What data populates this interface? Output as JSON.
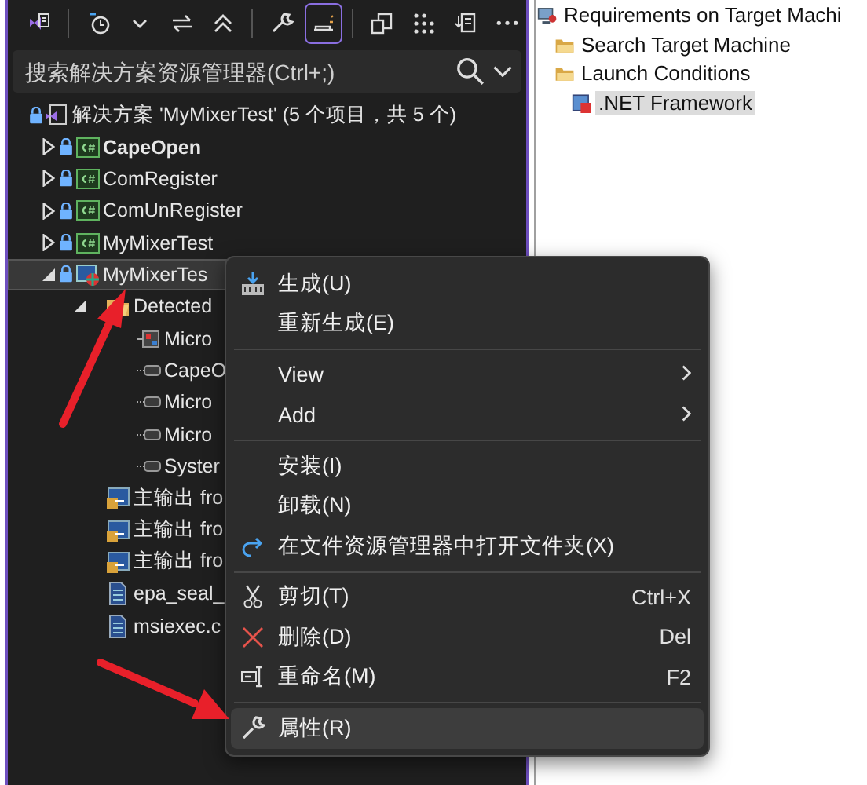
{
  "toolbar": {
    "buttons": [
      {
        "selected": false
      },
      {
        "selected": false
      },
      {
        "selected": false
      },
      {
        "selected": false
      },
      {
        "selected": false
      },
      {
        "selected": false
      },
      {
        "selected": true
      },
      {
        "selected": false
      },
      {
        "selected": false
      },
      {
        "selected": false
      },
      {
        "selected": false
      }
    ]
  },
  "search": {
    "placeholder": "搜索解决方案资源管理器(Ctrl+;)"
  },
  "solution_explorer": {
    "items": [
      {
        "label": "解决方案 'MyMixerTest' (5 个项目，共 5 个)",
        "kind": "solution",
        "locked": true,
        "bold": false,
        "selected": false,
        "children": [
          {
            "label": "CapeOpen",
            "kind": "csharp",
            "locked": true,
            "bold": true,
            "selected": false,
            "expanded": false
          },
          {
            "label": "ComRegister",
            "kind": "csharp",
            "locked": true,
            "bold": false,
            "selected": false,
            "expanded": false
          },
          {
            "label": "ComUnRegister",
            "kind": "csharp",
            "locked": true,
            "bold": false,
            "selected": false,
            "expanded": false
          },
          {
            "label": "MyMixerTest",
            "kind": "csharp",
            "locked": true,
            "bold": false,
            "selected": false,
            "expanded": false
          },
          {
            "label": "MyMixerTes",
            "kind": "setup",
            "locked": true,
            "bold": false,
            "selected": true,
            "expanded": true,
            "children": [
              {
                "label": "Detected",
                "kind": "folder",
                "locked": false,
                "bold": false,
                "selected": false,
                "expanded": true,
                "children": [
                  {
                    "label": "Micro",
                    "kind": "module",
                    "locked": false,
                    "bold": false,
                    "selected": false
                  },
                  {
                    "label": "CapeO",
                    "kind": "dependency",
                    "locked": false,
                    "bold": false,
                    "selected": false
                  },
                  {
                    "label": "Micro",
                    "kind": "dependency",
                    "locked": false,
                    "bold": false,
                    "selected": false
                  },
                  {
                    "label": "Micro",
                    "kind": "dependency",
                    "locked": false,
                    "bold": false,
                    "selected": false
                  },
                  {
                    "label": "Syster",
                    "kind": "dependency",
                    "locked": false,
                    "bold": false,
                    "selected": false
                  }
                ]
              },
              {
                "label": "主输出 fro",
                "kind": "output",
                "locked": false,
                "bold": false,
                "selected": false
              },
              {
                "label": "主输出 fro",
                "kind": "output",
                "locked": false,
                "bold": false,
                "selected": false
              },
              {
                "label": "主输出 fro",
                "kind": "output",
                "locked": false,
                "bold": false,
                "selected": false
              },
              {
                "label": "epa_seal_",
                "kind": "file",
                "locked": false,
                "bold": false,
                "selected": false
              },
              {
                "label": "msiexec.c",
                "kind": "file",
                "locked": false,
                "bold": false,
                "selected": false
              }
            ]
          }
        ]
      }
    ]
  },
  "context_menu": {
    "groups": [
      [
        {
          "label": "生成(U)",
          "submenu": false,
          "selected": false
        },
        {
          "label": "重新生成(E)",
          "submenu": false,
          "selected": false
        }
      ],
      [
        {
          "label": "View",
          "submenu": true,
          "selected": false
        },
        {
          "label": "Add",
          "submenu": true,
          "selected": false
        }
      ],
      [
        {
          "label": "安装(I)",
          "submenu": false,
          "selected": false
        },
        {
          "label": "卸载(N)",
          "submenu": false,
          "selected": false
        },
        {
          "label": "在文件资源管理器中打开文件夹(X)",
          "submenu": false,
          "selected": false
        }
      ],
      [
        {
          "label": "剪切(T)",
          "shortcut": "Ctrl+X",
          "submenu": false,
          "selected": false
        },
        {
          "label": "删除(D)",
          "shortcut": "Del",
          "submenu": false,
          "selected": false
        },
        {
          "label": "重命名(M)",
          "shortcut": "F2",
          "submenu": false,
          "selected": false
        }
      ],
      [
        {
          "label": "属性(R)",
          "submenu": false,
          "selected": true
        }
      ]
    ]
  },
  "launch_tree": {
    "items": [
      {
        "label": "Requirements on Target Machi",
        "kind": "requirements",
        "selected": false,
        "children": [
          {
            "label": "Search Target Machine",
            "kind": "folder",
            "selected": false
          },
          {
            "label": "Launch Conditions",
            "kind": "folder",
            "selected": false,
            "children": [
              {
                "label": ".NET Framework",
                "kind": "framework",
                "selected": true
              }
            ]
          }
        ]
      }
    ]
  }
}
